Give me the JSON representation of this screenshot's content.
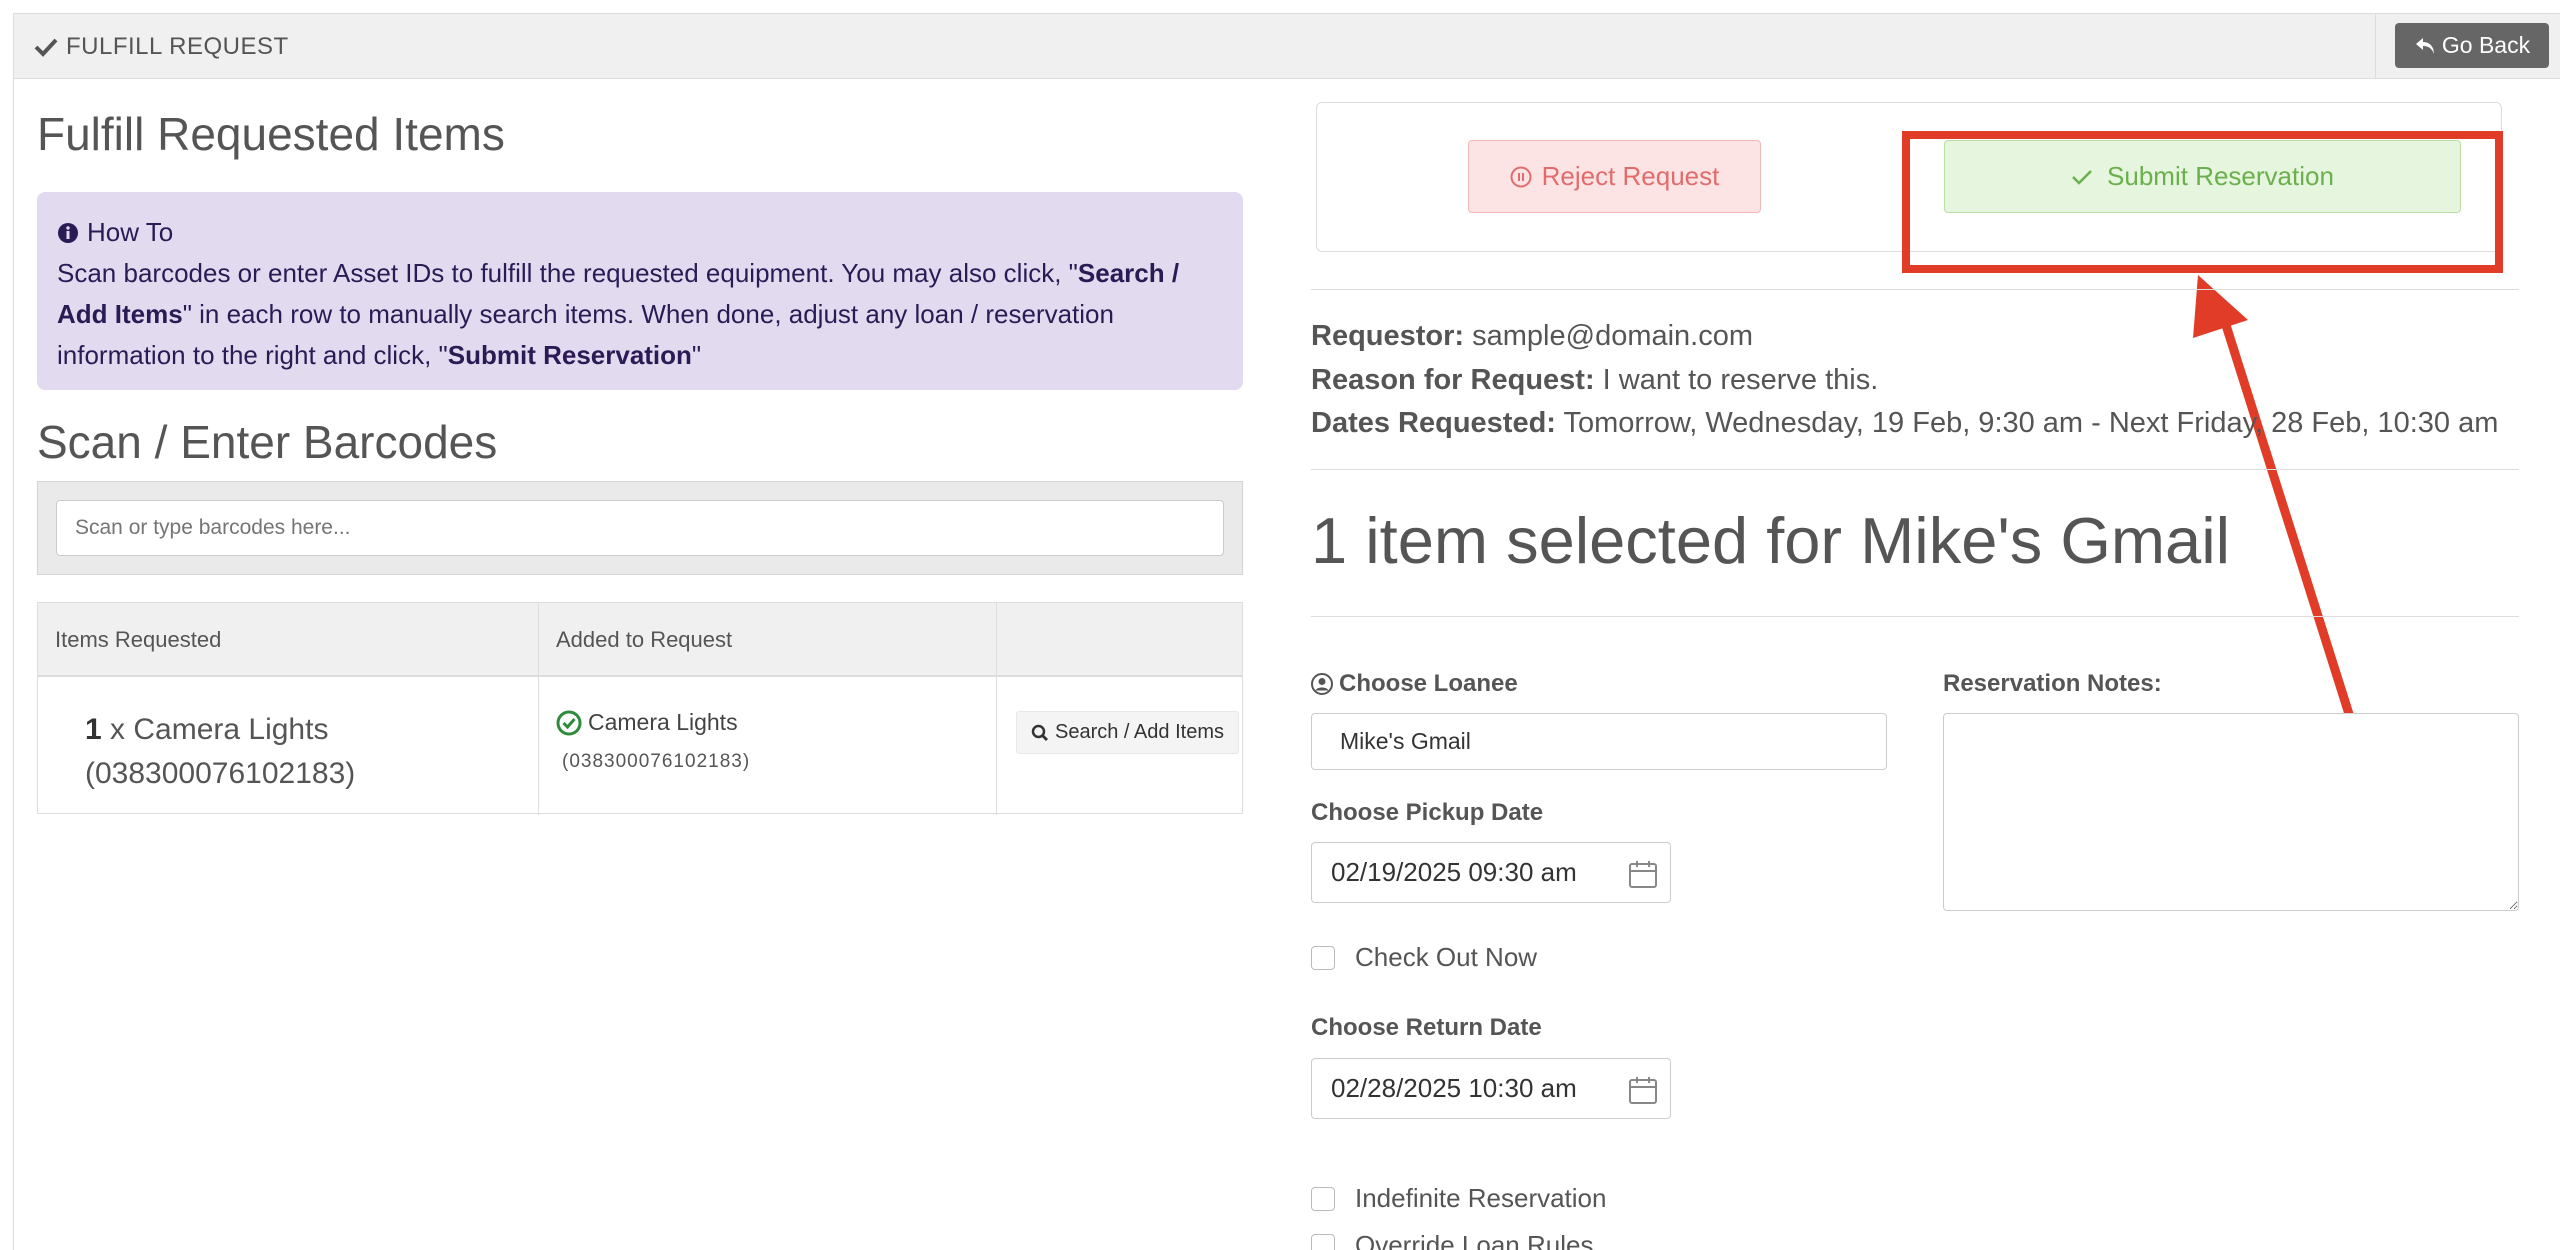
{
  "header": {
    "title": "FULFILL REQUEST",
    "go_back": "Go Back"
  },
  "left": {
    "title": "Fulfill Requested Items",
    "howto": {
      "title": "How To",
      "text_1": "Scan barcodes or enter Asset IDs to fulfill the requested equipment. You may also click, \"",
      "bold_1": "Search / Add Items",
      "text_2": "\" in each row to manually search items. When done, adjust any loan / reservation information to the right and click, \"",
      "bold_2": "Submit Reservation",
      "text_3": "\""
    },
    "scan_title": "Scan / Enter Barcodes",
    "scan_placeholder": "Scan or type barcodes here...",
    "table": {
      "headers": [
        "Items Requested",
        "Added to Request",
        ""
      ],
      "rows": [
        {
          "qty": "1",
          "qty_sep": " x Camera Lights",
          "requested_id": "(038300076102183)",
          "added_name": "Camera Lights",
          "added_id": "(038300076102183)",
          "action": "Search / Add Items"
        }
      ]
    }
  },
  "right": {
    "reject_label": "Reject Request",
    "submit_label": "Submit Reservation",
    "requestor_label": "Requestor:",
    "requestor_value": "sample@domain.com",
    "reason_label": "Reason for Request:",
    "reason_value": "I want to reserve this.",
    "dates_label": "Dates Requested:",
    "dates_value": "Tomorrow, Wednesday, 19 Feb, 9:30 am - Next Friday, 28 Feb, 10:30 am",
    "selected_title": "1 item selected for Mike's Gmail",
    "loanee_label": "Choose Loanee",
    "loanee_value": "Mike's Gmail",
    "notes_label": "Reservation Notes:",
    "pickup_label": "Choose Pickup Date",
    "pickup_value": "02/19/2025 09:30 am",
    "checkout_label": "Check Out Now",
    "return_label": "Choose Return Date",
    "return_value": "02/28/2025 10:30 am",
    "indefinite_label": "Indefinite Reservation",
    "override_label": "Override Loan Rules"
  },
  "colors": {
    "highlight": "#e03c28",
    "submit_text": "#6ab04c",
    "reject_text": "#e06c6c",
    "howto_bg": "#e2dbf0"
  }
}
